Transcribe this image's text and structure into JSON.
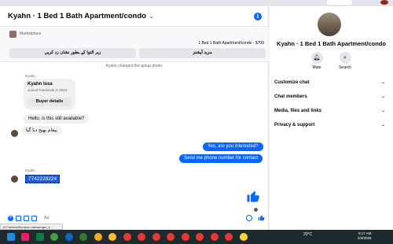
{
  "browser": {
    "top_pill": ""
  },
  "chat": {
    "title": "Kyahn · 1 Bed 1 Bath Apartment/condo",
    "marketplace": {
      "label": "Marketplace",
      "listing": "1 Bed 1 Bath Apartment/condo · $700",
      "buttons": [
        "زیر التوا کے بطور نشان زد کریں",
        "مزید آپشنز"
      ]
    },
    "system_message": "Kyahn changed the group photo.",
    "seller_label": "Kyahn",
    "buyer_card": {
      "name": "Kyahn Issa",
      "joined": "Joined Facebook in 2023",
      "button": "Buyer details"
    },
    "messages_in": [
      "Hello, is this still available?",
      "پیغام بھیج دیا گیا"
    ],
    "messages_out": [
      "Yes, are you interested?",
      "Send me phone number for contact"
    ],
    "sender_label_2": "Kyahn",
    "selected_text": "7742228224",
    "composer": {
      "aa": "Aa"
    },
    "status_url": "12/?referralSurface=messenger_li..."
  },
  "right_panel": {
    "name": "Kyahn · 1 Bed 1 Bath Apartment/condo",
    "actions": [
      {
        "label": "Mute",
        "icon": "bell-icon"
      },
      {
        "label": "Search",
        "icon": "search-icon"
      }
    ],
    "sections": [
      "Customize chat",
      "Chat members",
      "Media, files and links",
      "Privacy & support"
    ]
  },
  "taskbar": {
    "weather": "20°C",
    "time": "9:17 AM",
    "date": "2/3/2025",
    "icon_colors": [
      "#1e88e5",
      "#e91e63",
      "#0b7d3e",
      "#43a047",
      "#1565c0",
      "#2e7d32",
      "#f9a825",
      "#fbc02d",
      "#e53935",
      "#e53935",
      "#e53935",
      "#e53935",
      "#e53935",
      "#e53935",
      "#e53935",
      "#e53935",
      "#fdd835"
    ]
  }
}
